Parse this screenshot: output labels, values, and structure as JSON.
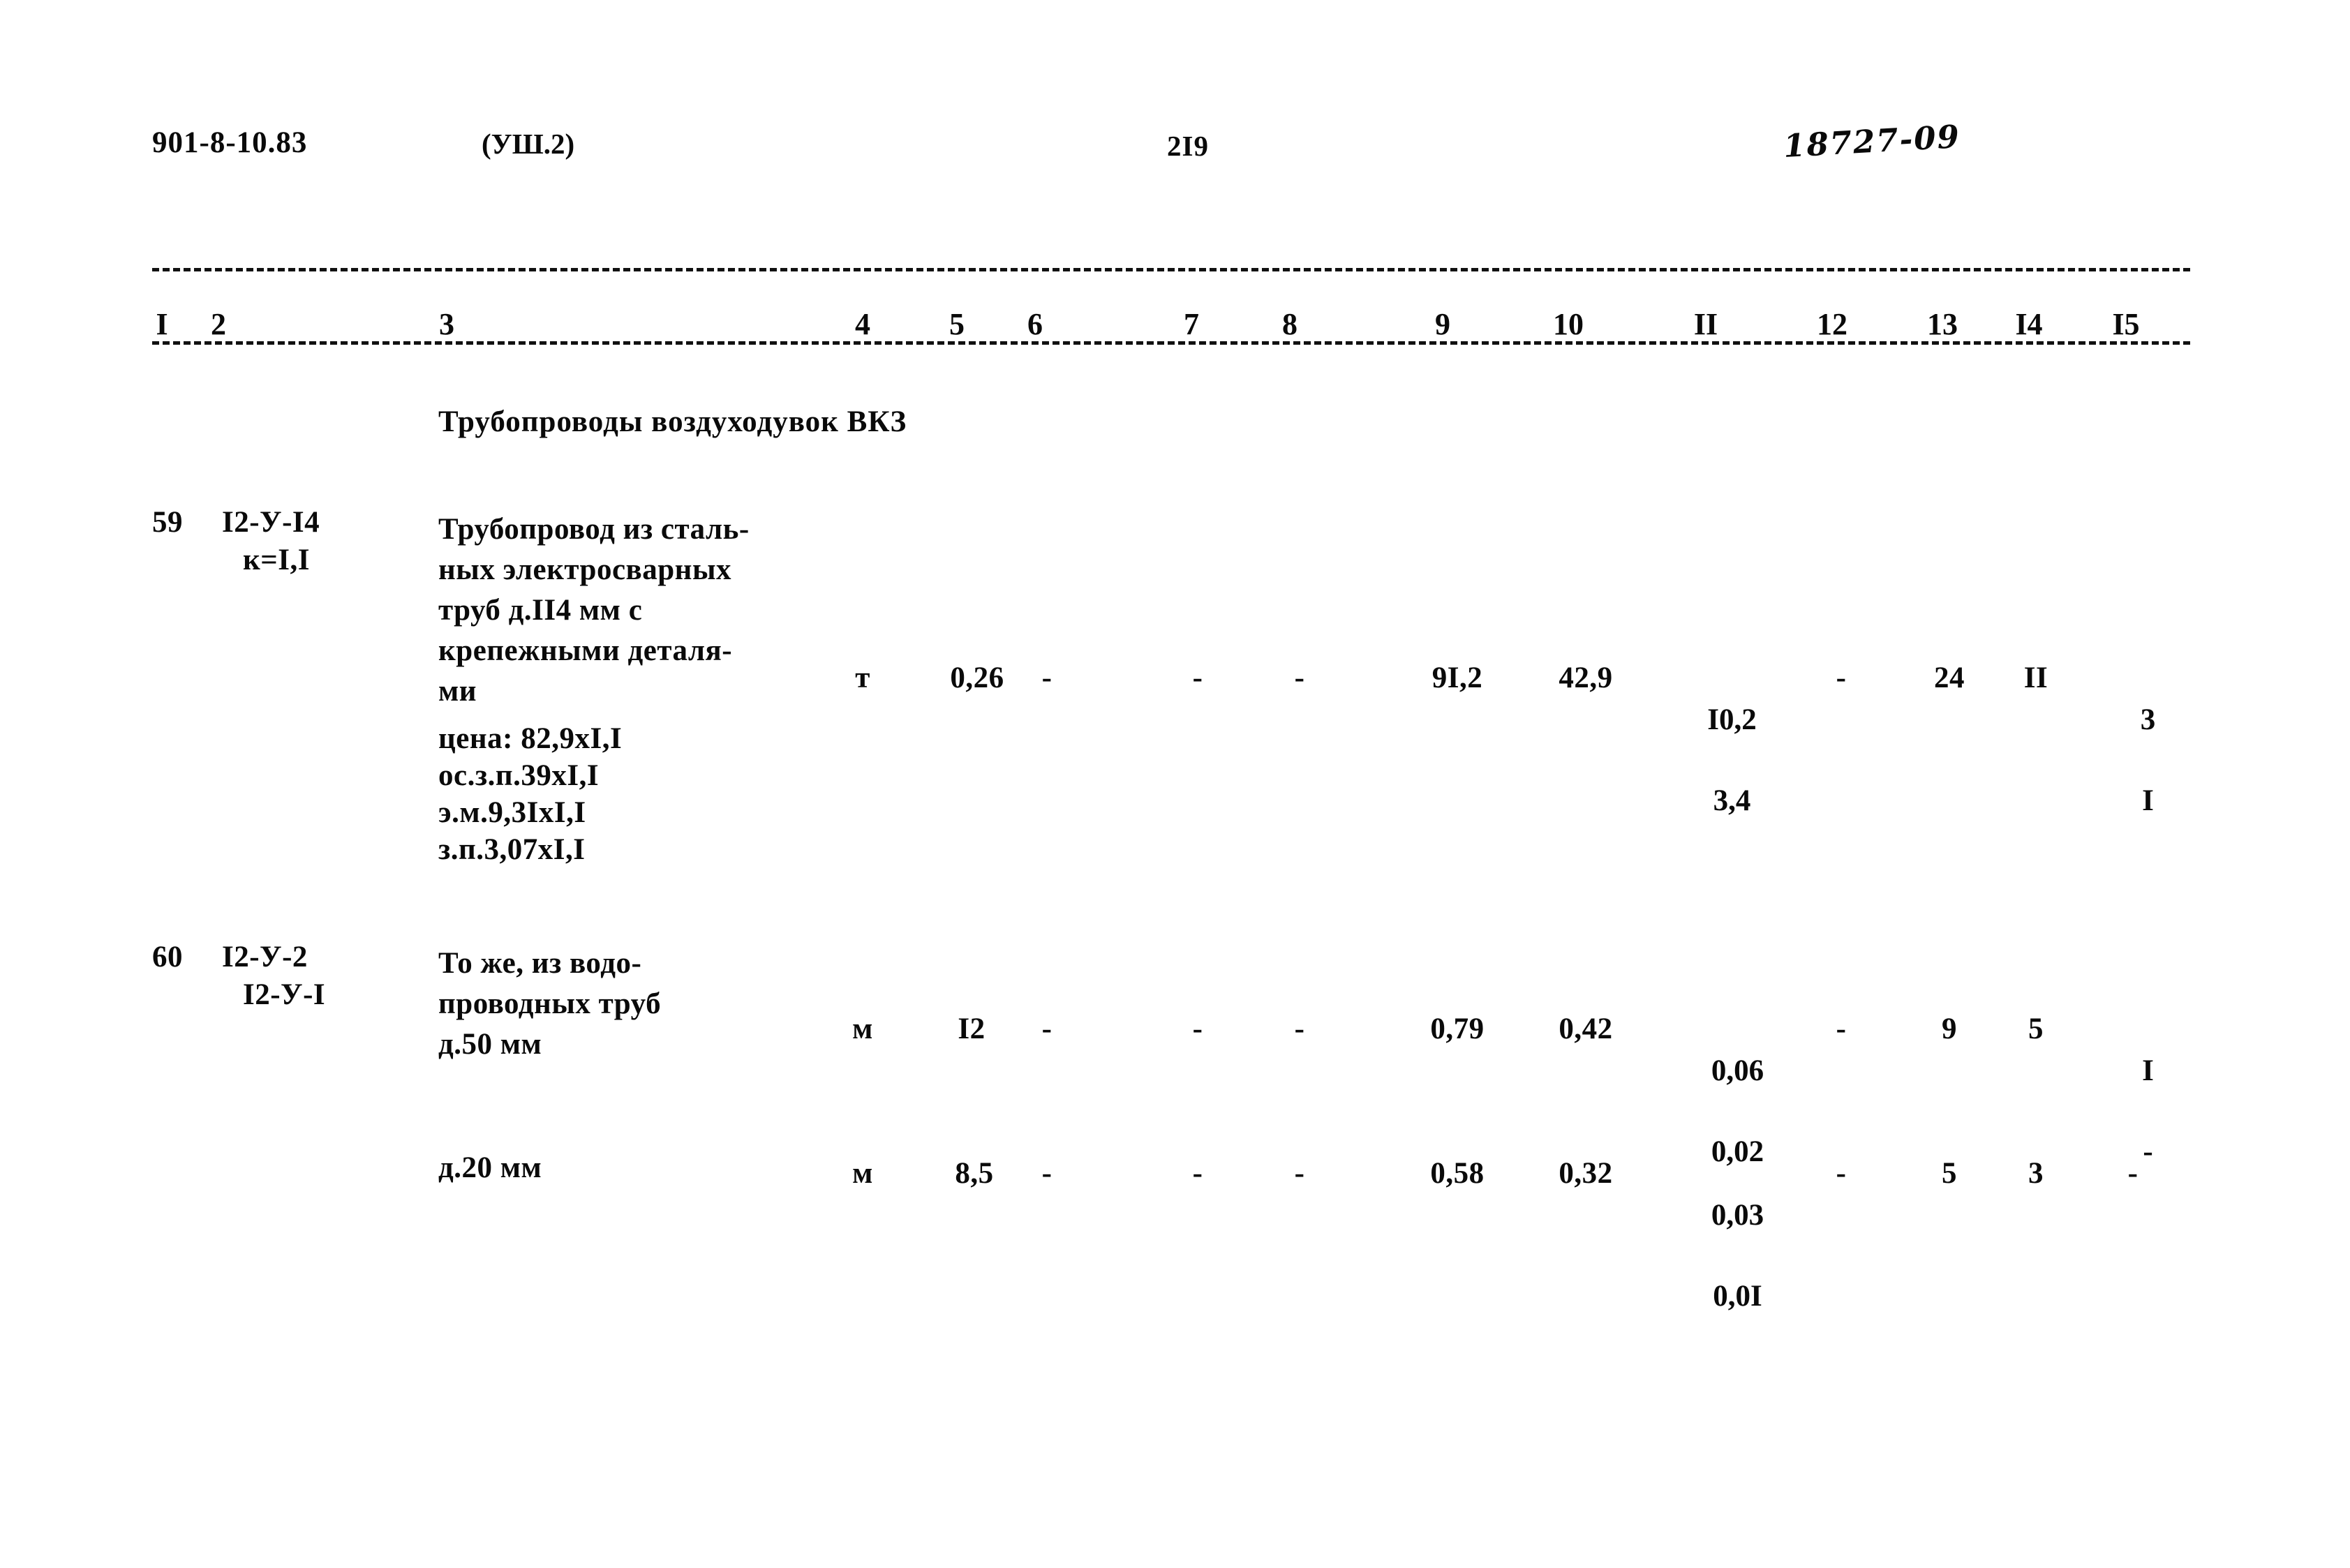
{
  "header": {
    "doc_code": "901-8-10.83",
    "variant": "(УШ.2)",
    "page_number": "2I9",
    "stamp": "18727-09"
  },
  "columns": {
    "labels": [
      "I",
      "2",
      "3",
      "4",
      "5",
      "6",
      "7",
      "8",
      "9",
      "10",
      "II",
      "12",
      "13",
      "I4",
      "I5"
    ],
    "x": [
      232,
      313,
      640,
      1236,
      1371,
      1483,
      1707,
      1848,
      2067,
      2247,
      2444,
      2625,
      2783,
      2907,
      3046
    ]
  },
  "section": {
    "title": "Трубопроводы воздуходувок ВКЗ"
  },
  "rows": [
    {
      "no": "59",
      "code_line1": "I2-У-I4",
      "code_line2": "к=I,I",
      "desc_lines": [
        "Трубопровод из сталь-",
        "ных электросварных",
        "труб д.II4 мм с",
        "крепежными деталя-",
        "ми"
      ],
      "price_lines": [
        "цена: 82,9xI,I",
        "ос.з.п.39xI,I",
        "э.м.9,3IxI,I",
        "з.п.3,07xI,I"
      ],
      "unit": "т",
      "c5": "0,26",
      "c6": "-",
      "c7": "-",
      "c8": "-",
      "c9": "9I,2",
      "c10": "42,9",
      "c11_top": "I0,2",
      "c11_bottom": "3,4",
      "c12": "-",
      "c13": "24",
      "c14": "II",
      "c15_top": "3",
      "c15_bottom": "I"
    },
    {
      "no": "60",
      "code_line1": "I2-У-2",
      "code_line2": "I2-У-I",
      "desc_lines": [
        "То же, из водо-",
        "проводных труб",
        "д.50 мм"
      ],
      "unit": "м",
      "c5": "I2",
      "c6": "-",
      "c7": "-",
      "c8": "-",
      "c9": "0,79",
      "c10": "0,42",
      "c11_top": "0,06",
      "c11_bottom": "0,02",
      "c12": "-",
      "c13": "9",
      "c14": "5",
      "c15_top": "I",
      "c15_bottom": "-"
    },
    {
      "no": "",
      "code_line1": "",
      "code_line2": "",
      "desc_lines": [
        "д.20 мм"
      ],
      "unit": "м",
      "c5": "8,5",
      "c6": "-",
      "c7": "-",
      "c8": "-",
      "c9": "0,58",
      "c10": "0,32",
      "c11_top": "0,03",
      "c11_bottom": "0,0I",
      "c12": "-",
      "c13": "5",
      "c14": "3",
      "c15_top": "-",
      "c15_bottom": ""
    }
  ]
}
